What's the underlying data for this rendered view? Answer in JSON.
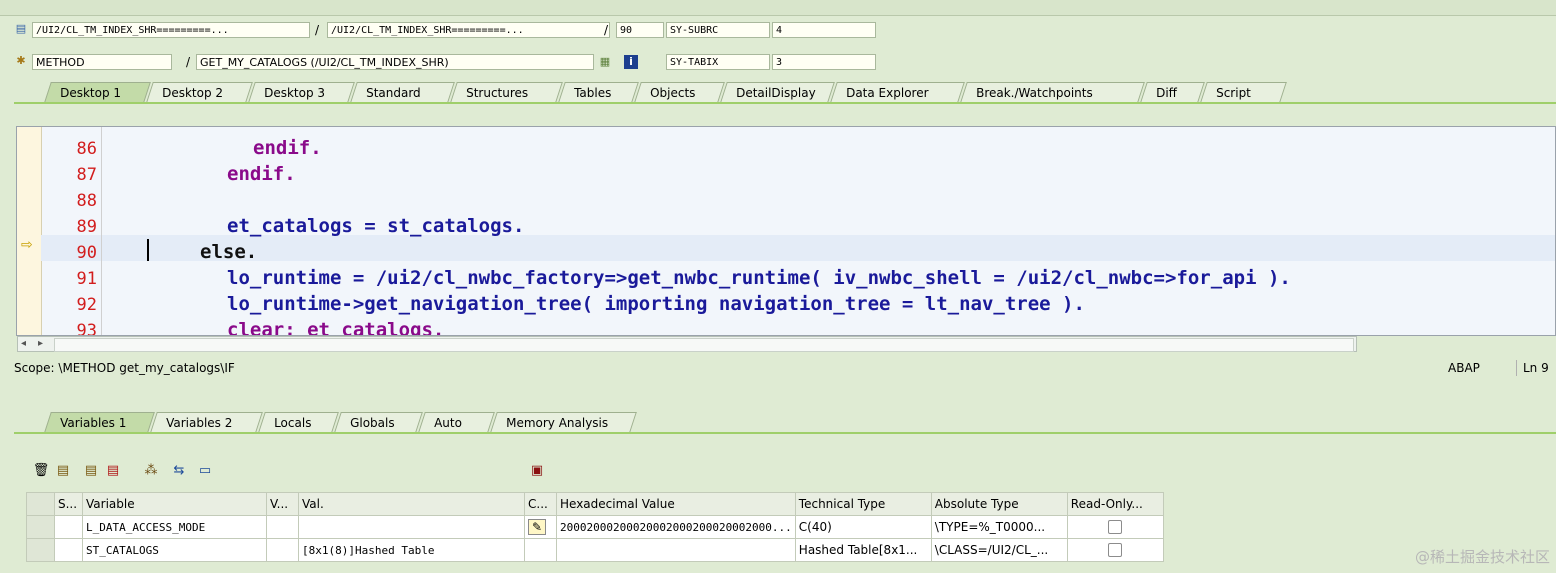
{
  "header": {
    "row1": {
      "program": "/UI2/CL_TM_INDEX_SHR=========...",
      "include": "/UI2/CL_TM_INDEX_SHR=========...",
      "line": "90",
      "sysfield_label": "SY-SUBRC",
      "sysfield_value": "4"
    },
    "row2": {
      "event_type": "METHOD",
      "event_name": "GET_MY_CATALOGS (/UI2/CL_TM_INDEX_SHR)",
      "sysfield_label": "SY-TABIX",
      "sysfield_value": "3"
    },
    "separators": {
      "slash": "/"
    }
  },
  "desktop_tabs": [
    {
      "label": "Desktop 1",
      "active": true
    },
    {
      "label": "Desktop 2"
    },
    {
      "label": "Desktop 3"
    },
    {
      "label": "Standard"
    },
    {
      "label": "Structures"
    },
    {
      "label": "Tables"
    },
    {
      "label": "Objects"
    },
    {
      "label": "DetailDisplay"
    },
    {
      "label": "Data Explorer"
    },
    {
      "label": "Break./Watchpoints"
    },
    {
      "label": "Diff"
    },
    {
      "label": "Script"
    }
  ],
  "editor": {
    "lines": [
      {
        "num": "86",
        "code": "endif."
      },
      {
        "num": "87",
        "code": "endif."
      },
      {
        "num": "88",
        "code": ""
      },
      {
        "num": "89",
        "code": "et_catalogs = st_catalogs."
      },
      {
        "num": "90",
        "code": "else."
      },
      {
        "num": "91",
        "code": "lo_runtime = /ui2/cl_nwbc_factory=>get_nwbc_runtime( iv_nwbc_shell = /ui2/cl_nwbc=>for_api )."
      },
      {
        "num": "92",
        "code": "lo_runtime->get_navigation_tree( importing navigation_tree = lt_nav_tree )."
      },
      {
        "num": "93",
        "code": "clear: et_catalogs."
      }
    ],
    "current_line": "90",
    "current_marker": "⇨"
  },
  "status": {
    "scope": "Scope: \\METHOD get_my_catalogs\\IF",
    "language": "ABAP",
    "position": "Ln 9"
  },
  "variable_tabs": [
    {
      "label": "Variables 1",
      "active": true
    },
    {
      "label": "Variables 2"
    },
    {
      "label": "Locals"
    },
    {
      "label": "Globals"
    },
    {
      "label": "Auto"
    },
    {
      "label": "Memory Analysis"
    }
  ],
  "toolbar_icons": [
    "delete-icon",
    "import-icon",
    "export-icon",
    "save-layout-icon",
    "hierarchy-icon",
    "transfer-icon",
    "new-tool-icon",
    "save-icon"
  ],
  "table": {
    "headers": [
      "S...",
      "Variable",
      "V...",
      "Val.",
      "C...",
      "Hexadecimal Value",
      "Technical Type",
      "Absolute Type",
      "Read-Only..."
    ],
    "rows": [
      {
        "variable": "L_DATA_ACCESS_MODE",
        "v": "",
        "val": "",
        "change_icon": "pencil-icon",
        "hex": "20002000200020002000200020002000...",
        "tech": "C(40)",
        "abs": "\\TYPE=%_T0000...",
        "readonly": false
      },
      {
        "variable": "ST_CATALOGS",
        "v": "",
        "val": "[8x1(8)]Hashed Table",
        "change_icon": "",
        "hex": "",
        "tech": "Hashed Table[8x1...",
        "abs": "\\CLASS=/UI2/CL_...",
        "readonly": false
      }
    ]
  },
  "watermark": "@稀土掘金技术社区",
  "colors": {
    "background": "#dfebd3",
    "keyword": "#8a0a8a",
    "identifier": "#1a1a9a",
    "line_number": "#d21d1d"
  }
}
